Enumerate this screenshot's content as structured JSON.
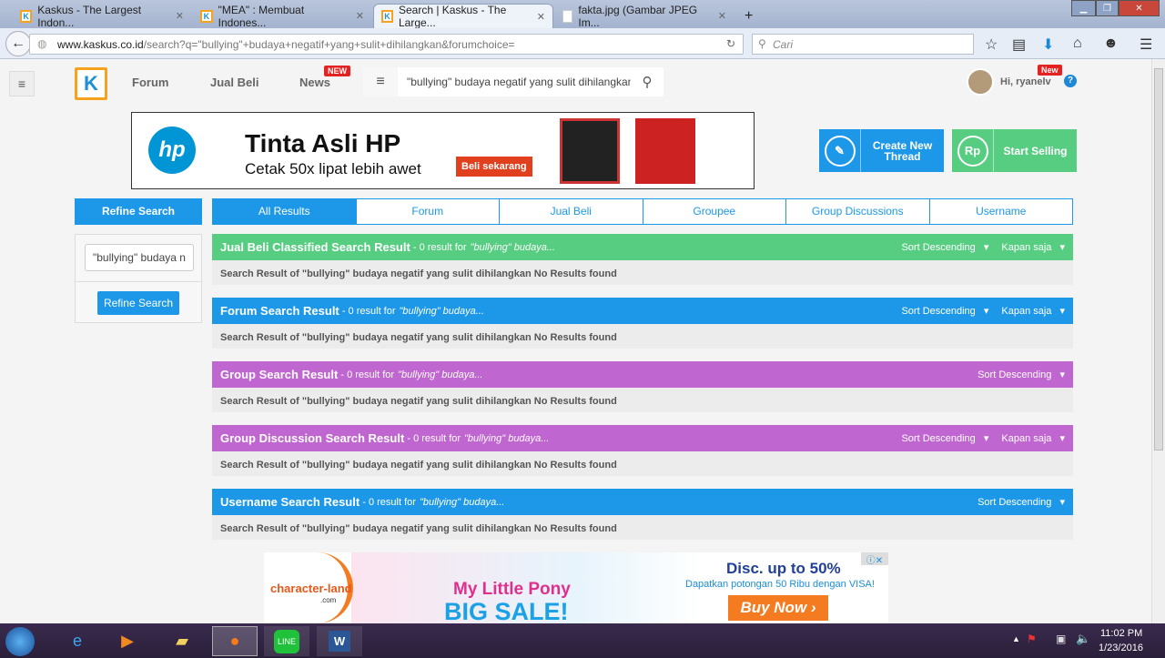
{
  "browser": {
    "tabs": [
      {
        "title": "Kaskus - The Largest Indon...",
        "active": false
      },
      {
        "title": "\"MEA\" : Membuat Indones...",
        "active": false
      },
      {
        "title": "Search | Kaskus - The Large...",
        "active": true
      },
      {
        "title": "fakta.jpg (Gambar JPEG Im...",
        "active": false
      }
    ],
    "new_tab": "+",
    "url_domain": "www.kaskus.co.id",
    "url_path": "/search?q=\"bullying\"+budaya+negatif+yang+sulit+dihilangkan&forumchoice=",
    "search_placeholder": "Cari"
  },
  "header": {
    "nav": [
      "Forum",
      "Jual Beli",
      "News"
    ],
    "news_badge": "NEW",
    "search_value": "\"bullying\" budaya negatif yang sulit dihilangkan",
    "user_greeting": "Hi, ryanelv",
    "user_badge": "New",
    "help": "?"
  },
  "ad_top": {
    "brand": "hp",
    "headline": "Tinta Asli HP",
    "sub": "Cetak 50x lipat lebih awet",
    "cta": "Beli sekarang"
  },
  "actions": {
    "create": "Create New Thread",
    "sell": "Start Selling",
    "sell_icon": "Rp"
  },
  "sidebar": {
    "title": "Refine Search",
    "input_value": "\"bullying\" budaya negatif yang sulit dihilangkan",
    "button": "Refine Search"
  },
  "result_tabs": [
    "All Results",
    "Forum",
    "Jual Beli",
    "Groupee",
    "Group Discussions",
    "Username"
  ],
  "sections": [
    {
      "title": "Jual Beli Classified Search Result",
      "count": "- 0 result for",
      "query": "\"bullying\" budaya...",
      "sort": "Sort Descending",
      "time": "Kapan saja",
      "body": "Search Result of \"bullying\" budaya negatif yang sulit dihilangkan No Results found",
      "color": "#57cd81"
    },
    {
      "title": "Forum Search Result",
      "count": "- 0 result for",
      "query": "\"bullying\" budaya...",
      "sort": "Sort Descending",
      "time": "Kapan saja",
      "body": "Search Result of \"bullying\" budaya negatif yang sulit dihilangkan No Results found",
      "color": "#1d98e9"
    },
    {
      "title": "Group Search Result",
      "count": "- 0 result for",
      "query": "\"bullying\" budaya...",
      "sort": "Sort Descending",
      "time": null,
      "body": "Search Result of \"bullying\" budaya negatif yang sulit dihilangkan No Results found",
      "color": "#c066d0"
    },
    {
      "title": "Group Discussion Search Result",
      "count": "- 0 result for",
      "query": "\"bullying\" budaya...",
      "sort": "Sort Descending",
      "time": "Kapan saja",
      "body": "Search Result of \"bullying\" budaya negatif yang sulit dihilangkan No Results found",
      "color": "#c066d0"
    },
    {
      "title": "Username Search Result",
      "count": "- 0 result for",
      "query": "\"bullying\" budaya...",
      "sort": "Sort Descending",
      "time": null,
      "body": "Search Result of \"bullying\" budaya negatif yang sulit dihilangkan No Results found",
      "color": "#1d98e9"
    }
  ],
  "ad_bottom": {
    "brand": "character-land",
    "brand_sub": ".com",
    "title1": "My Little Pony",
    "title2": "BIG SALE!",
    "disc": "Disc. up to 50%",
    "promo": "Dapatkan potongan 50 Ribu dengan VISA!",
    "cta": "Buy Now ›"
  },
  "taskbar": {
    "time": "11:02 PM",
    "date": "1/23/2016",
    "apps": [
      "start",
      "internet-explorer",
      "media-player",
      "file-explorer",
      "firefox",
      "line",
      "word"
    ]
  }
}
